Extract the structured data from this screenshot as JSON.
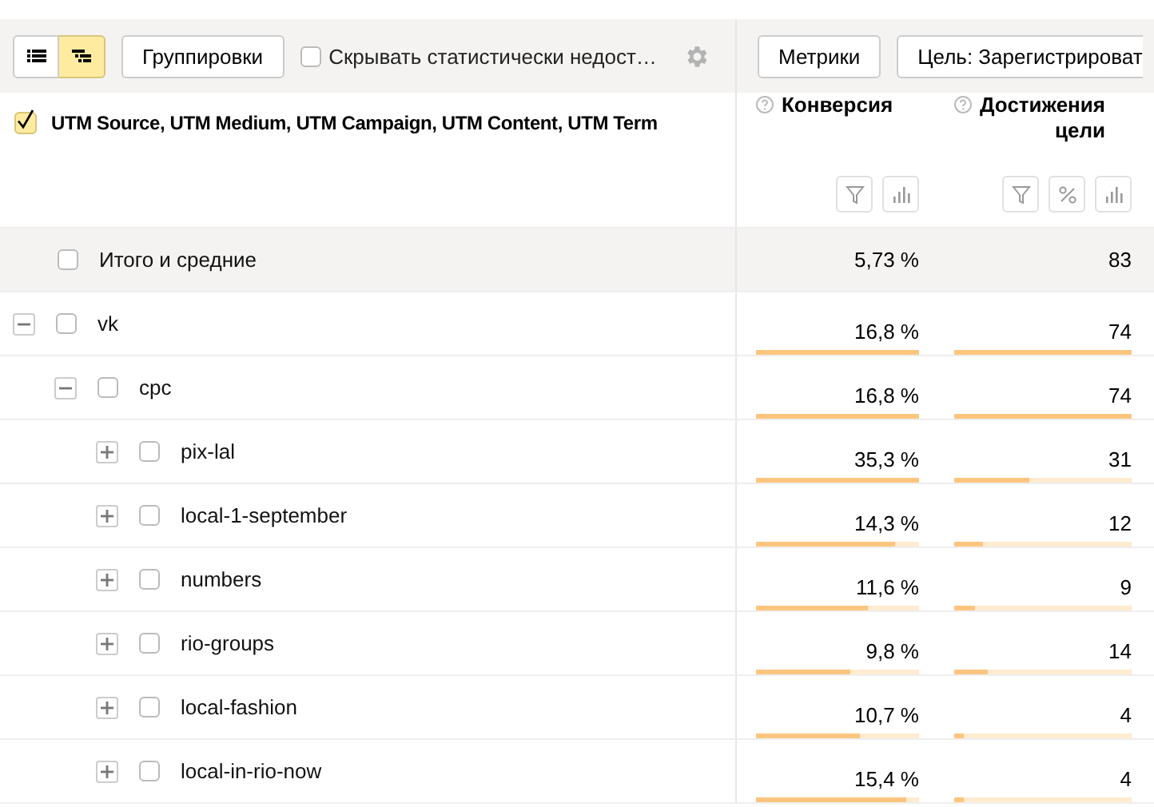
{
  "toolbar": {
    "view_modes": [
      {
        "kind": "list",
        "selected": false
      },
      {
        "kind": "tree",
        "selected": true
      }
    ],
    "groupings_button": "Группировки",
    "hide_checkbox": {
      "label": "Скрывать статистически недост…",
      "checked": false
    },
    "metrics_button": "Метрики",
    "goal_button": "Цель: Зарегистрироват"
  },
  "table": {
    "dimension_header": {
      "label": "UTM Source, UTM Medium, UTM Campaign, UTM Content, UTM Term",
      "checked": true
    },
    "columns": [
      {
        "label": "Конверсия",
        "tools": [
          {
            "kind": "filter"
          },
          {
            "kind": "chart"
          }
        ]
      },
      {
        "label": "Достижения цели",
        "tools": [
          {
            "kind": "filter"
          },
          {
            "kind": "percent"
          },
          {
            "kind": "chart"
          }
        ]
      }
    ],
    "totals": {
      "label": "Итого и средние",
      "checked": false,
      "values": [
        "5,73 %",
        "83"
      ]
    },
    "rows": [
      {
        "label": "vk",
        "checked": false,
        "expanded": true,
        "cells": [
          {
            "text": "16,8 %",
            "level": 1
          },
          {
            "text": "74",
            "level": 1
          }
        ],
        "children": [
          {
            "label": "cpc",
            "checked": false,
            "expanded": true,
            "cells": [
              {
                "text": "16,8 %",
                "level": 1
              },
              {
                "text": "74",
                "level": 1
              }
            ],
            "children": [
              {
                "label": "pix-lal",
                "checked": false,
                "expanded": false,
                "cells": [
                  {
                    "text": "35,3 %",
                    "level": 1
                  },
                  {
                    "text": "31",
                    "level": 0.42
                  }
                ]
              },
              {
                "label": "local-1-september",
                "checked": false,
                "expanded": false,
                "cells": [
                  {
                    "text": "14,3 %",
                    "level": 0.85
                  },
                  {
                    "text": "12",
                    "level": 0.16
                  }
                ]
              },
              {
                "label": "numbers",
                "checked": false,
                "expanded": false,
                "cells": [
                  {
                    "text": "11,6 %",
                    "level": 0.69
                  },
                  {
                    "text": "9",
                    "level": 0.12
                  }
                ]
              },
              {
                "label": "rio-groups",
                "checked": false,
                "expanded": false,
                "cells": [
                  {
                    "text": "9,8 %",
                    "level": 0.58
                  },
                  {
                    "text": "14",
                    "level": 0.19
                  }
                ]
              },
              {
                "label": "local-fashion",
                "checked": false,
                "expanded": false,
                "cells": [
                  {
                    "text": "10,7 %",
                    "level": 0.64
                  },
                  {
                    "text": "4",
                    "level": 0.05
                  }
                ]
              },
              {
                "label": "local-in-rio-now",
                "checked": false,
                "expanded": false,
                "cells": [
                  {
                    "text": "15,4 %",
                    "level": 0.92
                  },
                  {
                    "text": "4",
                    "level": 0.05
                  }
                ]
              }
            ]
          }
        ]
      }
    ]
  }
}
